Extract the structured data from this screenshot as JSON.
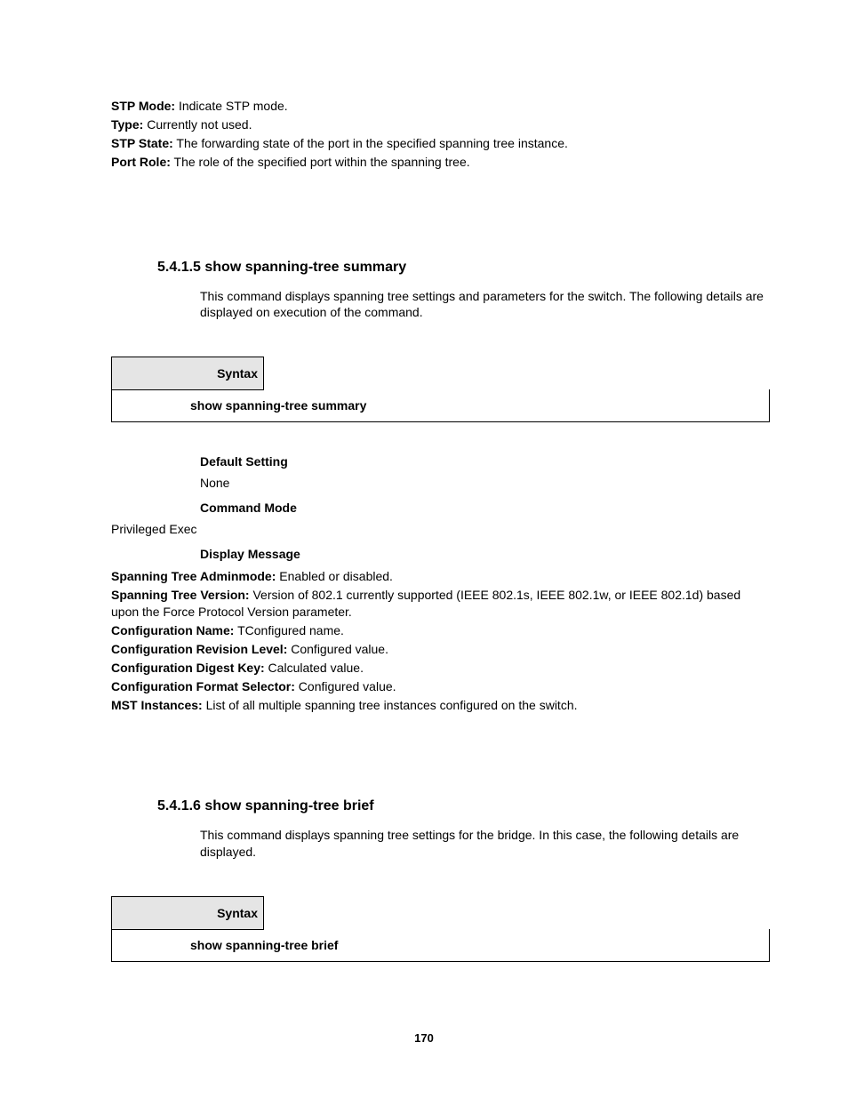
{
  "top_defs": [
    {
      "label": "STP Mode:",
      "value": " Indicate STP mode."
    },
    {
      "label": "Type:",
      "value": " Currently not used."
    },
    {
      "label": "STP State:",
      "value": " The forwarding state of the port in the specified spanning tree instance."
    },
    {
      "label": "Port Role:",
      "value": " The role of the specified port within the spanning tree."
    }
  ],
  "section1": {
    "heading": "5.4.1.5 show spanning-tree summary",
    "desc": "This command displays spanning tree settings and parameters for the switch. The following details are displayed on execution of the command.",
    "syntax_label": "Syntax",
    "syntax_cmd": "show spanning-tree summary",
    "default_heading": "Default Setting",
    "default_value": "None",
    "cmdmode_heading": "Command Mode",
    "cmdmode_value": "Privileged Exec",
    "display_heading": "Display Message",
    "messages": [
      {
        "label": "Spanning Tree Adminmode:",
        "value": " Enabled or disabled."
      },
      {
        "label": "Spanning Tree Version:",
        "value": " Version of 802.1 currently supported (IEEE 802.1s, IEEE 802.1w, or IEEE 802.1d) based upon the Force Protocol Version parameter."
      },
      {
        "label": "Configuration Name:",
        "value": " TConfigured name."
      },
      {
        "label": "Configuration Revision Level:",
        "value": " Configured value."
      },
      {
        "label": "Configuration Digest Key:",
        "value": " Calculated value."
      },
      {
        "label": "Configuration Format Selector:",
        "value": " Configured value."
      },
      {
        "label": "MST Instances:",
        "value": " List of all multiple spanning tree instances configured on the switch."
      }
    ]
  },
  "section2": {
    "heading": "5.4.1.6 show spanning-tree brief",
    "desc": "This command displays spanning tree settings for the bridge. In this case, the following details are displayed.",
    "syntax_label": "Syntax",
    "syntax_cmd": "show spanning-tree brief"
  },
  "page_number": "170"
}
